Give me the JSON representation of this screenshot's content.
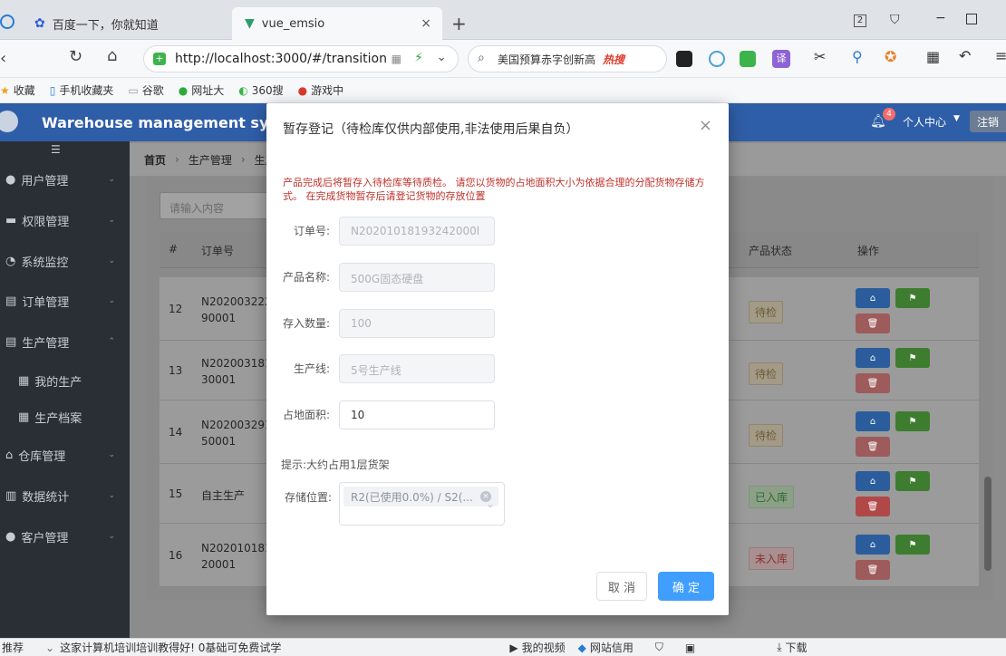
{
  "browser": {
    "tabs": [
      {
        "title": "百度一下，你就知道"
      },
      {
        "title": "vue_emsio"
      }
    ],
    "url": "http://localhost:3000/#/transition",
    "search_text": "美国预算赤字创新高",
    "hot_label": "热搜",
    "window_count": "2",
    "bookmarks": [
      "收藏",
      "手机收藏夹",
      "谷歌",
      "网址大",
      "360搜",
      "游戏中"
    ],
    "status_left": "推荐",
    "status_ad": "这家计算机培训培训教得好! 0基础可免费试学",
    "status_right": [
      "我的视频",
      "网站信用",
      "下载"
    ]
  },
  "app": {
    "title": "Warehouse management system",
    "notify_count": "4",
    "user_center": "个人中心",
    "logout": "注销",
    "sidebar": [
      {
        "label": "用户管理"
      },
      {
        "label": "权限管理"
      },
      {
        "label": "系统监控"
      },
      {
        "label": "订单管理"
      },
      {
        "label": "生产管理"
      },
      {
        "label": "我的生产"
      },
      {
        "label": "生产档案"
      },
      {
        "label": "仓库管理"
      },
      {
        "label": "数据统计"
      },
      {
        "label": "客户管理"
      }
    ],
    "breadcrumb": [
      "首页",
      "生产管理",
      "生产"
    ],
    "search_placeholder": "请输入内容",
    "table": {
      "headers": [
        "#",
        "订单号",
        "产品状态",
        "操作"
      ],
      "rows": [
        {
          "no": "12",
          "order": "N20200322290001",
          "status": "待检"
        },
        {
          "no": "13",
          "order": "N20200318130001",
          "status": "待检"
        },
        {
          "no": "14",
          "order": "N20200329150001",
          "status": "待检"
        },
        {
          "no": "15",
          "order": "自主生产",
          "status": "已入库"
        },
        {
          "no": "16",
          "order": "N20201018120001",
          "status": "未入库"
        }
      ]
    }
  },
  "modal": {
    "title": "暂存登记（待检库仅供内部使用,非法使用后果自负）",
    "note": "产品完成后将暂存入待检库等待质检。 请您以货物的占地面积大小为依据合理的分配货物存储方式。 在完成货物暂存后请登记货物的存放位置",
    "fields": [
      {
        "label": "订单号:",
        "value": "N20201018193242000l"
      },
      {
        "label": "产品名称:",
        "value": "500G固态硬盘"
      },
      {
        "label": "存入数量:",
        "value": "100"
      },
      {
        "label": "生产线:",
        "value": "5号生产线"
      },
      {
        "label": "占地面积:",
        "value": "10"
      }
    ],
    "hint": "提示:大约占用1层货架",
    "location_label": "存储位置:",
    "location_tag": "R2(已使用0.0%) / S2(...",
    "cancel": "取 消",
    "ok": "确 定"
  }
}
